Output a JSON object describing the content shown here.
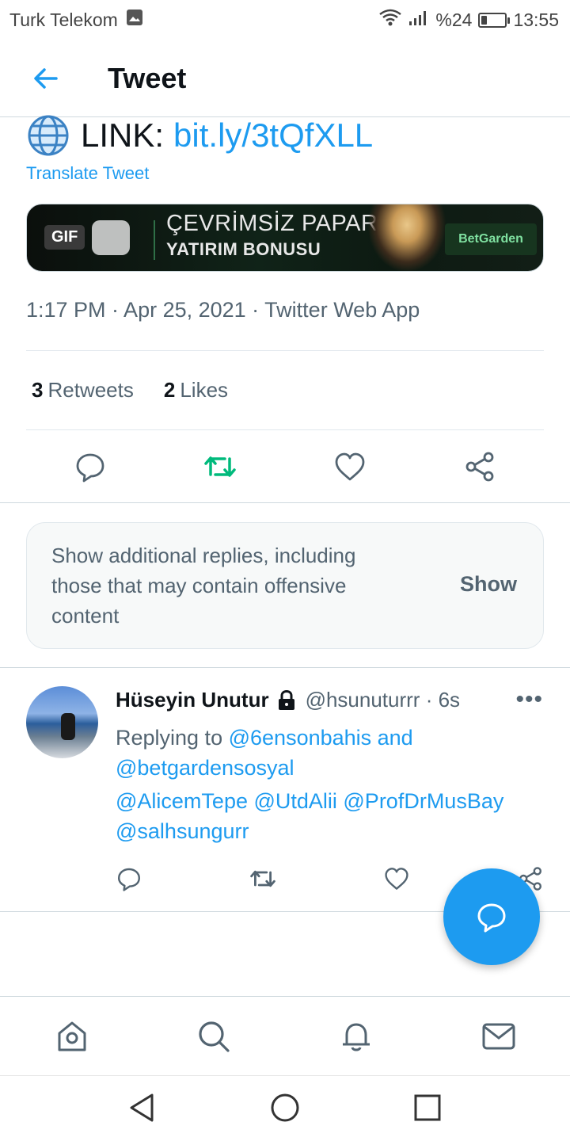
{
  "status_bar": {
    "carrier": "Turk Telekom",
    "battery_text": "%24",
    "battery_level": 0.24,
    "time": "13:55",
    "icons": [
      "image-icon",
      "wifi-icon",
      "signal-icon",
      "battery-icon"
    ]
  },
  "header": {
    "title": "Tweet",
    "back_icon": "arrow-left-icon"
  },
  "tweet": {
    "link_label": "LINK:",
    "link_url": "bit.ly/3tQfXLL",
    "translate": "Translate Tweet",
    "media": {
      "gif_badge": "GIF",
      "line1": "ÇEVRİMSİZ PAPARA",
      "line2": "YATIRIM BONUSU",
      "brand": "BetGarden"
    },
    "meta": "1:17 PM · Apr 25, 2021 · Twitter Web App",
    "stats": {
      "retweets_count": "3",
      "retweets_label": "Retweets",
      "likes_count": "2",
      "likes_label": "Likes"
    }
  },
  "more_replies": {
    "text": "Show additional replies, including those that may contain offensive content",
    "button": "Show"
  },
  "reply": {
    "name": "Hüseyin Unutur",
    "handle": "@hsunuturrr · 6s",
    "replying_prefix": "Replying to",
    "replying_mentions": "@6ensonbahis and @betgardensosyal",
    "body": "@AlicemTepe @UtdAlii @ProfDrMusBay @salhsungurr"
  },
  "colors": {
    "accent": "#1d9bf0",
    "retweet_green": "#00ba7c",
    "secondary_text": "#536471"
  }
}
